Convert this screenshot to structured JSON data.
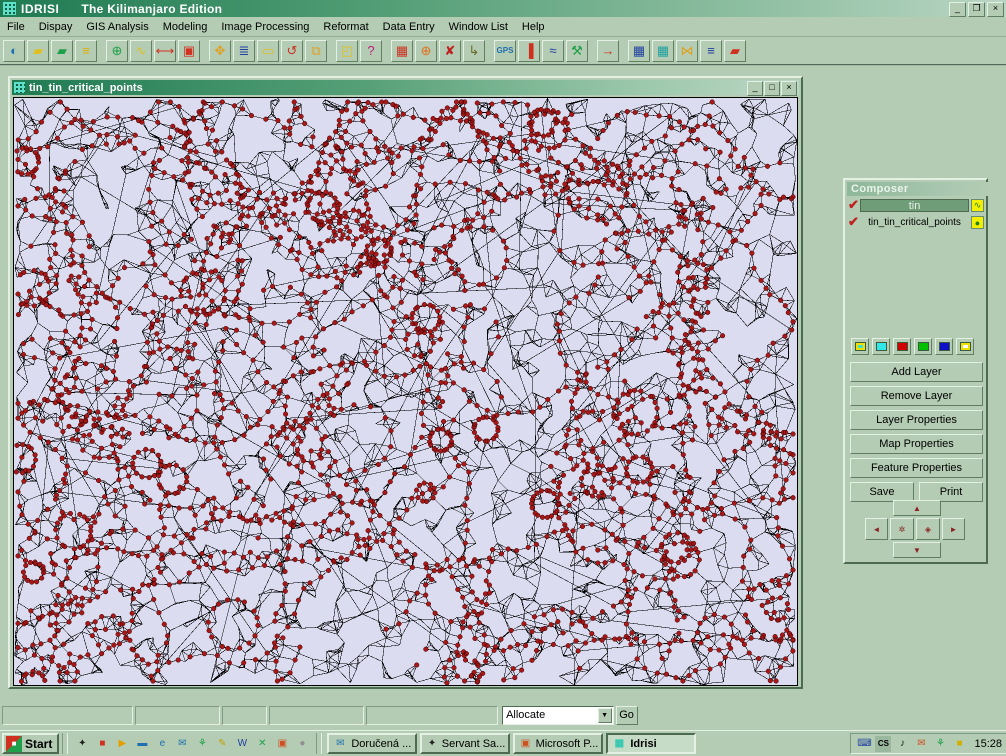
{
  "app": {
    "name": "IDRISI",
    "edition": "The Kilimanjaro Edition",
    "icon": "idrisi-app-icon"
  },
  "window_controls": {
    "minimize": "_",
    "restore": "❐",
    "close": "×"
  },
  "menu": {
    "items": [
      {
        "label": "File"
      },
      {
        "label": "Dispay"
      },
      {
        "label": "GIS Analysis"
      },
      {
        "label": "Modeling"
      },
      {
        "label": "Image Processing"
      },
      {
        "label": "Reformat"
      },
      {
        "label": "Data Entry"
      },
      {
        "label": "Window List"
      },
      {
        "label": "Help"
      }
    ]
  },
  "toolbar": {
    "buttons": [
      {
        "name": "idrisi-explorer-icon",
        "glyph": "◐",
        "color": "#1f6fb0"
      },
      {
        "name": "open-folder-icon",
        "glyph": "▰",
        "color": "#e0c020"
      },
      {
        "name": "display-layers-icon",
        "glyph": "▰",
        "color": "#20a04a"
      },
      {
        "name": "list-properties-icon",
        "glyph": "≡",
        "color": "#e0b000"
      },
      {
        "name": "world-map-icon",
        "glyph": "⊕",
        "color": "#20a04a"
      },
      {
        "name": "add-layer-icon",
        "glyph": "∿",
        "color": "#e0c020"
      },
      {
        "name": "zoom-extents-icon",
        "glyph": "⟷",
        "color": "#d03020"
      },
      {
        "name": "group-link-icon",
        "glyph": "▣",
        "color": "#d03020"
      },
      {
        "name": "pan-icon",
        "glyph": "✥",
        "color": "#e0a020"
      },
      {
        "name": "layer-stack-icon",
        "glyph": "≣",
        "color": "#2040a0"
      },
      {
        "name": "select-window-icon",
        "glyph": "▭",
        "color": "#e0c020"
      },
      {
        "name": "restore-view-icon",
        "glyph": "↺",
        "color": "#d03020"
      },
      {
        "name": "feature-link-icon",
        "glyph": "⧉",
        "color": "#e0a020"
      },
      {
        "name": "placement-icon",
        "glyph": "◰",
        "color": "#e0c020"
      },
      {
        "name": "query-cursor-icon",
        "glyph": "?",
        "color": "#c02080"
      },
      {
        "name": "table-query-icon",
        "glyph": "▦",
        "color": "#d03020"
      },
      {
        "name": "digitize-point-icon",
        "glyph": "⊕",
        "color": "#e07020"
      },
      {
        "name": "delete-feature-icon",
        "glyph": "✘",
        "color": "#c02020"
      },
      {
        "name": "end-digitize-icon",
        "glyph": "↳",
        "color": "#6a6a2a"
      },
      {
        "name": "gps-icon",
        "glyph": "GPS",
        "color": "#1f6fb0"
      },
      {
        "name": "histogram-icon",
        "glyph": "▐",
        "color": "#d03020"
      },
      {
        "name": "filter-icon",
        "glyph": "≈",
        "color": "#2040a0"
      },
      {
        "name": "profile-icon",
        "glyph": "⚒",
        "color": "#20a04a"
      },
      {
        "name": "import-icon",
        "glyph": "→",
        "color": "#d03020"
      },
      {
        "name": "grid-table-icon",
        "glyph": "▦",
        "color": "#2040a0"
      },
      {
        "name": "database-table-icon",
        "glyph": "▦",
        "color": "#20a0a0"
      },
      {
        "name": "collection-editor-icon",
        "glyph": "⋈",
        "color": "#e0a020"
      },
      {
        "name": "text-editor-icon",
        "glyph": "≡",
        "color": "#2040a0"
      },
      {
        "name": "macro-modeler-icon",
        "glyph": "▰",
        "color": "#d03020"
      }
    ]
  },
  "map_window": {
    "title": "tin_tin_critical_points",
    "icon": "idrisi-doc-icon",
    "controls": {
      "minimize": "_",
      "maximize": "□",
      "close": "×"
    },
    "canvas": {
      "background_color": "#dcdcf0",
      "line_color": "#000000",
      "point_color": "#a81818",
      "description": "TIN triangulated irregular network with critical points overlay"
    }
  },
  "composer": {
    "title": "Composer",
    "layers": [
      {
        "check": "✔",
        "name": "tin",
        "selected": true,
        "symbol": "∿",
        "symbol_bg": "#f0f000",
        "symbol_color": "#208020"
      },
      {
        "check": "✔",
        "name": "tin_tin_critical_points",
        "selected": false,
        "symbol": "●",
        "symbol_bg": "#f0f000",
        "symbol_color": "#208020"
      }
    ],
    "palette_buttons": [
      {
        "name": "palette-layers-yellow",
        "color": "#f0e000",
        "inner": "#40e0d0"
      },
      {
        "name": "palette-cyan",
        "color": "#30e8e8",
        "inner": "#30e8e8"
      },
      {
        "name": "palette-red",
        "color": "#d00000",
        "inner": "#d00000"
      },
      {
        "name": "palette-green",
        "color": "#00c000",
        "inner": "#00c000"
      },
      {
        "name": "palette-blue",
        "color": "#1010c8",
        "inner": "#1010c8"
      },
      {
        "name": "palette-layers-white",
        "color": "#f0e000",
        "inner": "#ffffff"
      }
    ],
    "buttons": [
      {
        "label": "Add Layer"
      },
      {
        "label": "Remove Layer"
      },
      {
        "label": "Layer Properties"
      },
      {
        "label": "Map Properties"
      },
      {
        "label": "Feature Properties"
      }
    ],
    "save_label": "Save",
    "print_label": "Print",
    "nav": {
      "up": "▲",
      "down": "▼",
      "left": "◄",
      "right": "►",
      "full_extent": "✲",
      "recenter": "◈"
    }
  },
  "statusbar": {
    "panels": [
      "",
      "",
      "",
      "",
      ""
    ],
    "command": {
      "value": "Allocate",
      "arrow": "▼",
      "go_label": "Go"
    }
  },
  "taskbar": {
    "start_label": "Start",
    "start_icon": "windows-flag-icon",
    "quick_launch": [
      {
        "name": "servant-salamander-icon",
        "glyph": "✦",
        "color": "#202020"
      },
      {
        "name": "colors-icon",
        "glyph": "■",
        "color": "#d03020"
      },
      {
        "name": "media-player-icon",
        "glyph": "▶",
        "color": "#e0a000"
      },
      {
        "name": "show-desktop-icon",
        "glyph": "▬",
        "color": "#1f6fb0"
      },
      {
        "name": "internet-explorer-icon",
        "glyph": "e",
        "color": "#1f6fb0"
      },
      {
        "name": "outlook-icon",
        "glyph": "✉",
        "color": "#1f6fb0"
      },
      {
        "name": "lite-icon",
        "glyph": "⚘",
        "color": "#20a04a"
      },
      {
        "name": "notepad-icon",
        "glyph": "✎",
        "color": "#c0a000"
      },
      {
        "name": "word-icon",
        "glyph": "W",
        "color": "#2040a0"
      },
      {
        "name": "excel-icon",
        "glyph": "✕",
        "color": "#20a04a"
      },
      {
        "name": "powerpoint-icon",
        "glyph": "▣",
        "color": "#d05020"
      },
      {
        "name": "cd-icon",
        "glyph": "●",
        "color": "#909090"
      }
    ],
    "tasks": [
      {
        "label": "Doručená ...",
        "icon": "outlook-icon",
        "glyph": "✉",
        "color": "#1f6fb0",
        "active": false
      },
      {
        "label": "Servant Sa...",
        "icon": "servant-salamander-icon",
        "glyph": "✦",
        "color": "#202020",
        "active": false
      },
      {
        "label": "Microsoft P...",
        "icon": "powerpoint-icon",
        "glyph": "▣",
        "color": "#d05020",
        "active": false
      },
      {
        "label": "Idrisi",
        "icon": "idrisi-app-icon",
        "glyph": "▦",
        "color": "#30c8b0",
        "active": true
      }
    ],
    "tray": {
      "icons": [
        {
          "name": "network-icon",
          "glyph": "⌨",
          "color": "#2040a0"
        },
        {
          "name": "language-indicator",
          "glyph": "CS",
          "color": "#000000"
        },
        {
          "name": "volume-icon",
          "glyph": "♪",
          "color": "#202020"
        },
        {
          "name": "mail-notify-icon",
          "glyph": "✉",
          "color": "#d05020"
        },
        {
          "name": "lite-tray-icon",
          "glyph": "⚘",
          "color": "#20a04a"
        },
        {
          "name": "colors-tray-icon",
          "glyph": "■",
          "color": "#d0b000"
        }
      ],
      "clock": "15:28"
    }
  }
}
